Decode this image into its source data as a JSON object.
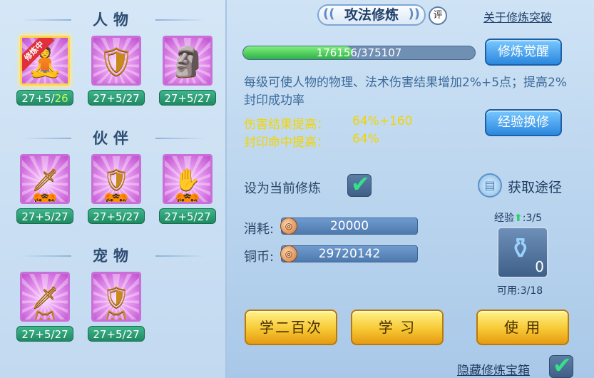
{
  "left": {
    "categories": [
      {
        "title": "人物",
        "items": [
          {
            "icon": "meditation-figure-icon",
            "glyph": "🧘",
            "ribbon": "修炼中",
            "selected": true,
            "level_base": "27+5/",
            "level_cur": "26"
          },
          {
            "icon": "shield-warrior-icon",
            "glyph": "🛡",
            "level": "27+5/27"
          },
          {
            "icon": "armored-warrior-icon",
            "glyph": "🗿",
            "level": "27+5/27"
          }
        ]
      },
      {
        "title": "伙伴",
        "items": [
          {
            "icon": "sword-tiger-icon",
            "glyph": "🗡🐯",
            "level": "27+5/27"
          },
          {
            "icon": "shield-tiger-icon",
            "glyph": "🛡🐯",
            "level": "27+5/27"
          },
          {
            "icon": "gauntlet-tiger-icon",
            "glyph": "✋🐯",
            "level": "27+5/27"
          }
        ]
      },
      {
        "title": "宠物",
        "items": [
          {
            "icon": "sword-cat-icon",
            "glyph": "🗡🐱",
            "level": "27+5/27"
          },
          {
            "icon": "shield-cat-icon",
            "glyph": "🛡🐱",
            "level": "27+5/27"
          }
        ]
      }
    ]
  },
  "header": {
    "title": "攻法修炼",
    "review_badge": "评",
    "breakthrough_link": "关于修炼突破"
  },
  "progress": {
    "text": "176156/375107",
    "fraction": 0.47
  },
  "buttons": {
    "awaken": "修炼觉醒",
    "exp_exchange": "经验换修",
    "learn_200": "学二百次",
    "learn": "学 习",
    "use": "使 用"
  },
  "description": "每级可使人物的物理、法术伤害结果增加2%+5点；提高2%封印成功率",
  "bonuses": [
    {
      "label": "伤害结果提高：",
      "value": "64%+160"
    },
    {
      "label": "封印命中提高：",
      "value": "64%"
    }
  ],
  "set_current": {
    "label": "设为当前修炼",
    "checked": true
  },
  "obtain": {
    "label": "获取途径"
  },
  "cost": {
    "label": "消耗:",
    "value": "20000"
  },
  "copper": {
    "label": "铜币:",
    "value": "29720142"
  },
  "exp_item": {
    "label": "经验",
    "progress": ":3/5",
    "count": "0",
    "available": "可用:3/18"
  },
  "hide_chest": {
    "label": "隐藏修炼宝箱",
    "checked": true
  },
  "colors": {
    "accent_gold": "#f1d400",
    "progress_green": "#2fb04a",
    "button_blue": "#2b87de"
  }
}
